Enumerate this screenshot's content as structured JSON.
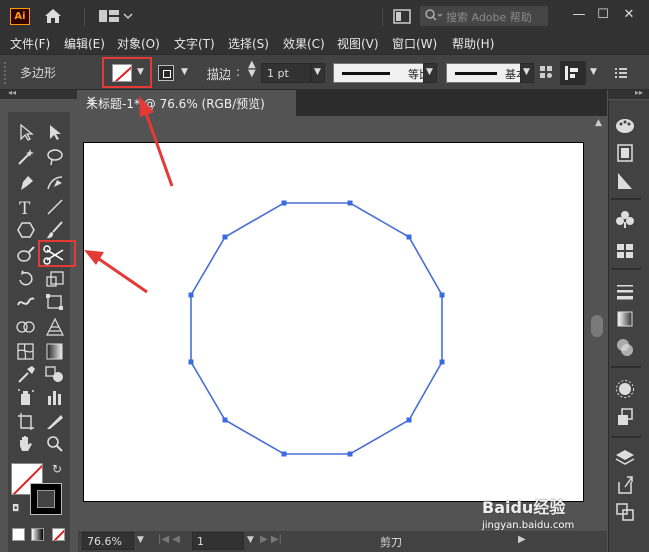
{
  "app": {
    "logo": "Ai",
    "search_placeholder": "搜索 Adobe 帮助",
    "window_controls": [
      "—",
      "☐",
      "✕"
    ]
  },
  "menu": [
    "文件(F)",
    "编辑(E)",
    "对象(O)",
    "文字(T)",
    "选择(S)",
    "效果(C)",
    "视图(V)",
    "窗口(W)",
    "帮助(H)"
  ],
  "control_bar": {
    "object_type": "多边形",
    "stroke_label": "描边",
    "stroke_weight": "1 pt",
    "profile_label": "等比",
    "brush_label": "基本",
    "fill_color": "none-red-slash"
  },
  "document": {
    "tab_title": "未标题-1* @ 76.6% (RGB/预览)",
    "close": "✕"
  },
  "status_bar": {
    "zoom": "76.6%",
    "artboard_number": "1",
    "current_tool": "剪刀"
  },
  "watermark": {
    "brand": "Baidu经验",
    "url": "jingyan.baidu.com"
  },
  "colors": {
    "highlight_red": "#e53935",
    "polygon_stroke": "#4a6fd4",
    "anchor": "#3a6be0"
  }
}
